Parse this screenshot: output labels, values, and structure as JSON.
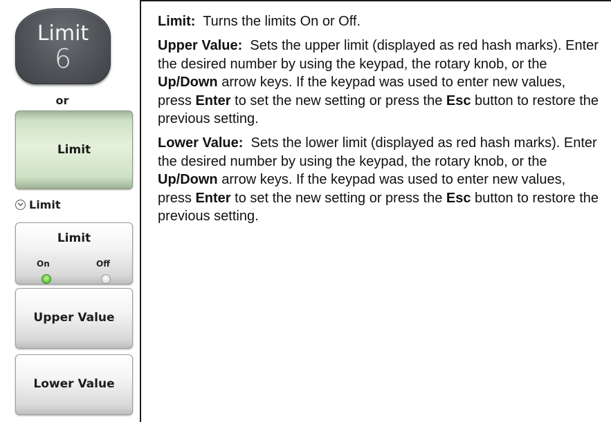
{
  "hardkey": {
    "label": "Limit",
    "digit": "6"
  },
  "or_text": "or",
  "main_softkey": {
    "label": "Limit"
  },
  "submenu": {
    "title": "Limit"
  },
  "softkeys": {
    "limit": {
      "label": "Limit",
      "on_label": "On",
      "off_label": "Off",
      "state": "On"
    },
    "upper_value": {
      "label": "Upper Value"
    },
    "lower_value": {
      "label": "Lower Value"
    }
  },
  "descriptions": {
    "limit": {
      "term": "Limit:",
      "text": "Turns the limits On or Off."
    },
    "upper_value": {
      "term": "Upper Value:",
      "p1": "Sets the upper limit (displayed as red hash marks). Enter the desired number by using the keypad, the rotary knob, or the ",
      "b1": "Up/Down",
      "p2": " arrow keys. If the keypad was used to enter new values, press ",
      "b2": "Enter",
      "p3": " to set the new setting or press the ",
      "b3": "Esc",
      "p4": " button to restore the previous setting."
    },
    "lower_value": {
      "term": "Lower Value:",
      "p1": "Sets the lower limit (displayed as red hash marks). Enter the desired number by using the keypad, the rotary knob, or the ",
      "b1": "Up/Down",
      "p2": " arrow keys. If the keypad was used to enter new values, press ",
      "b2": "Enter",
      "p3": " to set the new setting or press the ",
      "b3": "Esc",
      "p4": " button to restore the previous setting."
    }
  }
}
